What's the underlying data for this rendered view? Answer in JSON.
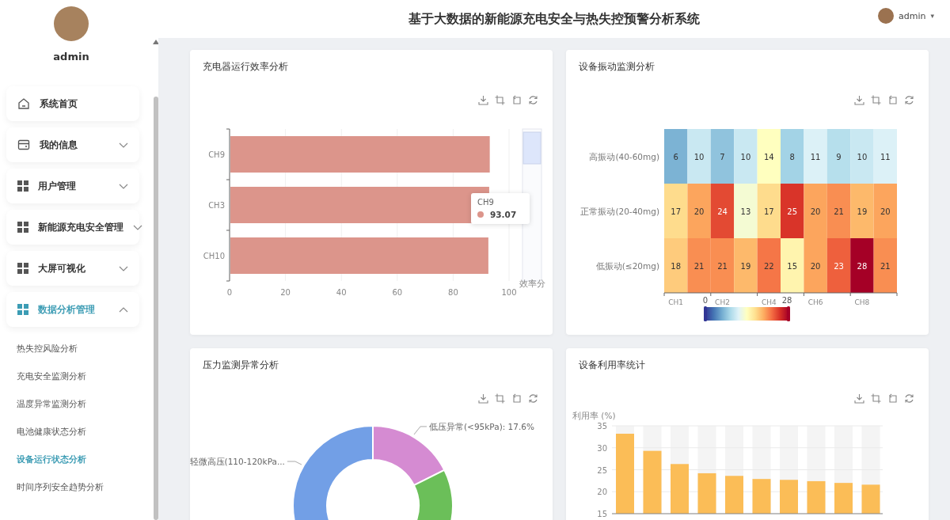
{
  "header": {
    "title": "基于大数据的新能源充电安全与热失控预警分析系统",
    "user": {
      "name": "admin",
      "caret": "▾"
    }
  },
  "sidebar": {
    "user_name": "admin",
    "menu": [
      {
        "label": "系统首页",
        "kind": "home",
        "selected": false
      },
      {
        "label": "我的信息",
        "kind": "card",
        "expanded": false,
        "selected": false
      },
      {
        "label": "用户管理",
        "kind": "grid",
        "expanded": false,
        "selected": false
      },
      {
        "label": "新能源充电安全管理",
        "kind": "grid",
        "expanded": false,
        "selected": false
      },
      {
        "label": "大屏可视化",
        "kind": "grid",
        "expanded": false,
        "selected": false
      },
      {
        "label": "数据分析管理",
        "kind": "grid",
        "expanded": true,
        "selected": true,
        "children": [
          {
            "label": "热失控风险分析",
            "selected": false
          },
          {
            "label": "充电安全监测分析",
            "selected": false
          },
          {
            "label": "温度异常监测分析",
            "selected": false
          },
          {
            "label": "电池健康状态分析",
            "selected": false
          },
          {
            "label": "设备运行状态分析",
            "selected": true
          },
          {
            "label": "时间序列安全趋势分析",
            "selected": false
          }
        ]
      }
    ]
  },
  "panels": {
    "efficiency": {
      "title": "充电器运行效率分析",
      "chart_data": {
        "type": "bar",
        "orientation": "horizontal",
        "categories": [
          "CH9",
          "CH3",
          "CH10"
        ],
        "series": [
          {
            "name": "效率分",
            "color": "#dc958b",
            "values": [
              93.1,
              92.9,
              92.6
            ]
          }
        ],
        "grid": true,
        "xlim": [
          0,
          100
        ],
        "xticks": [
          0,
          20,
          40,
          60,
          80,
          100
        ]
      },
      "tooltip": {
        "title": "CH9",
        "value": "93.07"
      }
    },
    "vibration": {
      "title": "设备振动监测分析",
      "heatmap": {
        "rows": [
          {
            "label": "高振动(40-60mg)",
            "cells": [
              "6",
              "10",
              "7",
              "10",
              "14",
              "8",
              "11",
              "9",
              "10",
              "11"
            ]
          },
          {
            "label": "正常振动(20-40mg)",
            "cells": [
              "17",
              "20",
              "24",
              "13",
              "17",
              "25",
              "20",
              "21",
              "19",
              "20"
            ]
          },
          {
            "label": "低振动(≤20mg)",
            "cells": [
              "18",
              "21",
              "21",
              "19",
              "22",
              "15",
              "20",
              "23",
              "28",
              "21"
            ]
          }
        ],
        "column_labels": [
          "CH1",
          "CH2",
          "CH4",
          "CH6",
          "CH8"
        ],
        "scale_min": "0",
        "scale_max": "28"
      }
    },
    "pressure": {
      "title": "压力监测异常分析",
      "slices": [
        {
          "color": "#d58bd2",
          "label": "低压异常(<95kPa): 17.6%"
        },
        {
          "color": "#6bbf59"
        },
        {
          "color": "#729fe6",
          "label": "轻微高压(110-120kPa..."
        }
      ]
    },
    "utilization": {
      "title": "设备利用率统计",
      "chart_data": {
        "type": "bar",
        "ylabel": "利用率 (%)",
        "series": [
          {
            "color": "#fbbd57",
            "values": [
              33.2,
              29.3,
              26.3,
              24.2,
              23.6,
              22.9,
              22.7,
              22.4,
              22.0,
              21.6
            ]
          }
        ],
        "grid": true,
        "ylim": [
          15,
          35
        ],
        "yticks": [
          15,
          20,
          25,
          30,
          35
        ]
      }
    }
  }
}
